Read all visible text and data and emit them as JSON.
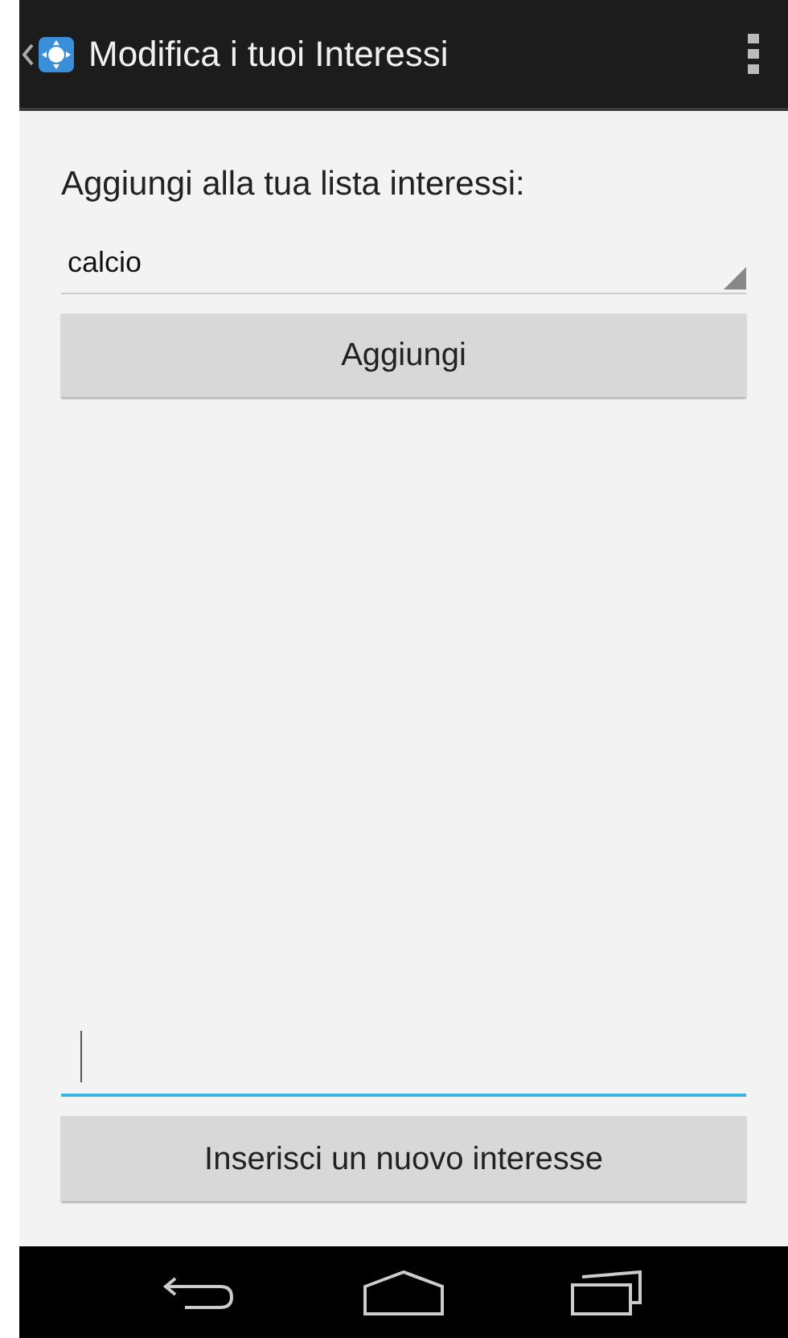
{
  "action_bar": {
    "title": "Modifica i tuoi Interessi"
  },
  "label": "Aggiungi alla tua lista interessi:",
  "spinner": {
    "value": "calcio"
  },
  "add_button": "Aggiungi",
  "new_interest_field": {
    "focused": true
  },
  "insert_button": "Inserisci un nuovo interesse"
}
